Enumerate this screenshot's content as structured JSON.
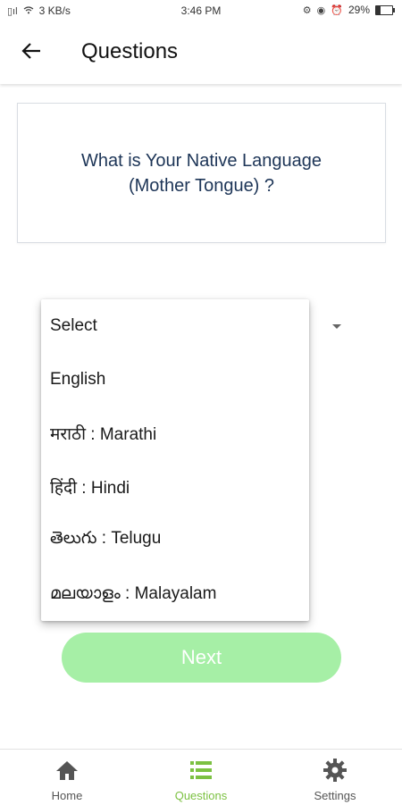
{
  "status_bar": {
    "network_speed": "3 KB/s",
    "time": "3:46 PM",
    "battery": "29%",
    "battery_level": 0.29
  },
  "app_bar": {
    "title": "Questions",
    "back_icon": "arrow-left-icon"
  },
  "question": {
    "text": "What is Your Native Language (Mother Tongue) ?"
  },
  "language_dropdown": {
    "selected": "Select",
    "options": [
      "Select",
      "English",
      "मराठी : Marathi",
      "हिंदी : Hindi",
      "తెలుగు : Telugu",
      "മലയാളം : Malayalam"
    ]
  },
  "next_button": {
    "label": "Next",
    "color": "#a6efa6"
  },
  "bottom_nav": {
    "items": [
      {
        "label": "Home",
        "icon": "home-icon"
      },
      {
        "label": "Questions",
        "icon": "list-icon"
      },
      {
        "label": "Settings",
        "icon": "gear-icon"
      }
    ],
    "active_color": "#7cc142"
  }
}
